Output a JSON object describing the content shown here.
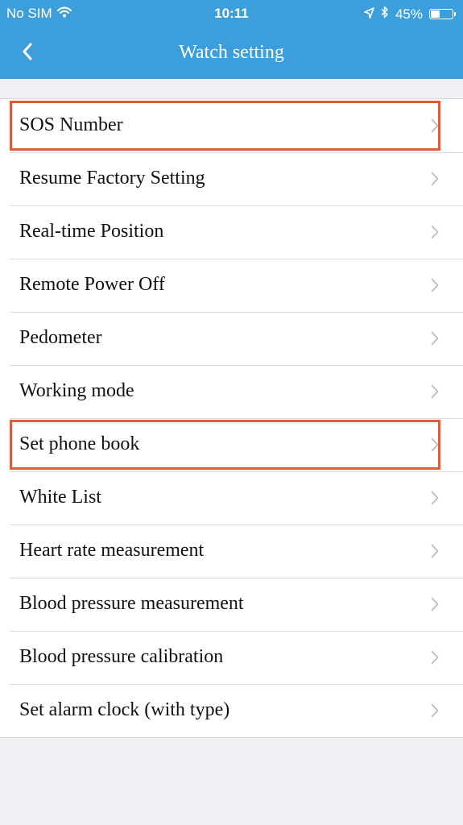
{
  "status_bar": {
    "carrier": "No SIM",
    "time": "10:11",
    "battery_percent": "45%",
    "battery_level": 0.45
  },
  "nav": {
    "title": "Watch setting",
    "back_icon": "chevron-left-icon"
  },
  "colors": {
    "header_background": "#3c9fdb",
    "highlight_border": "#e05a3c",
    "page_background": "#efeff4"
  },
  "settings": {
    "items": [
      {
        "label": "SOS Number",
        "highlighted": true
      },
      {
        "label": "Resume Factory Setting",
        "highlighted": false
      },
      {
        "label": "Real-time Position",
        "highlighted": false
      },
      {
        "label": "Remote Power Off",
        "highlighted": false
      },
      {
        "label": "Pedometer",
        "highlighted": false
      },
      {
        "label": "Working mode",
        "highlighted": false
      },
      {
        "label": "Set phone book",
        "highlighted": true
      },
      {
        "label": "White List",
        "highlighted": false
      },
      {
        "label": "Heart rate measurement",
        "highlighted": false
      },
      {
        "label": "Blood pressure measurement",
        "highlighted": false
      },
      {
        "label": "Blood pressure calibration",
        "highlighted": false
      },
      {
        "label": "Set alarm clock (with type)",
        "highlighted": false
      }
    ]
  }
}
